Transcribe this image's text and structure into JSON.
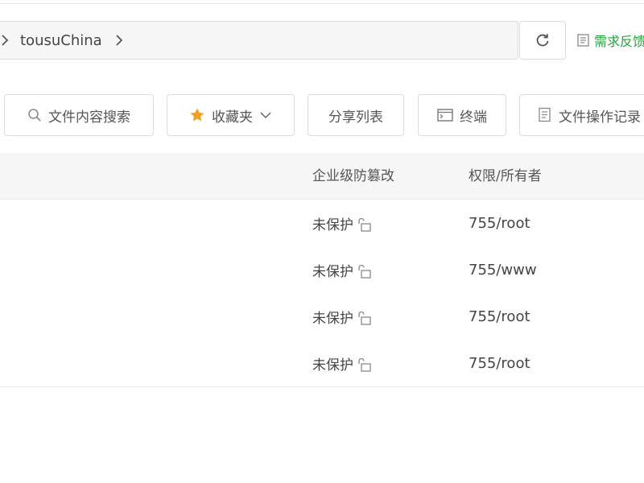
{
  "path": {
    "segments": [
      "tousuChina"
    ],
    "refresh_icon": "refresh-icon"
  },
  "feedback": {
    "label": "需求反馈",
    "color": "#20a53a"
  },
  "toolbar": {
    "search_label": "文件内容搜索",
    "favorites_label": "收藏夹",
    "share_label": "分享列表",
    "terminal_label": "终端",
    "log_label": "文件操作记录"
  },
  "table": {
    "columns": [
      "企业级防篡改",
      "权限/所有者"
    ],
    "rows": [
      {
        "protection": "未保护",
        "permission": "755/root"
      },
      {
        "protection": "未保护",
        "permission": "755/www"
      },
      {
        "protection": "未保护",
        "permission": "755/root"
      },
      {
        "protection": "未保护",
        "permission": "755/root"
      }
    ]
  },
  "colors": {
    "accent_green": "#20a53a",
    "star": "#f0a020"
  }
}
